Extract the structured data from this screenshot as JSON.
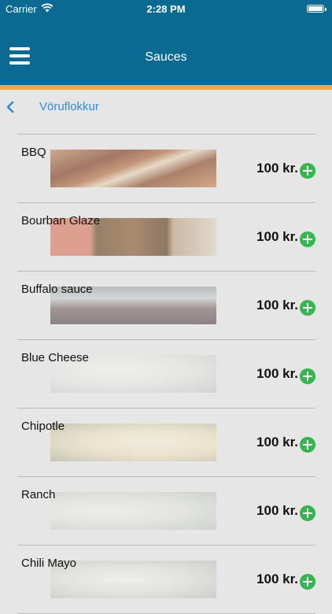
{
  "status_bar": {
    "carrier": "Carrier",
    "time": "2:28 PM"
  },
  "nav": {
    "title": "Sauces",
    "menu_icon": "hamburger-icon"
  },
  "back": {
    "label": "Vöruflokkur",
    "icon": "chevron-left-icon"
  },
  "colors": {
    "nav_bg": "#0b6a92",
    "accent_strip": "#f0a44a",
    "link": "#2f8be0",
    "add_button": "#33b74e"
  },
  "products": [
    {
      "name": "BBQ",
      "price": "100 kr."
    },
    {
      "name": "Bourban Glaze",
      "price": "100 kr."
    },
    {
      "name": "Buffalo sauce",
      "price": "100 kr."
    },
    {
      "name": "Blue Cheese",
      "price": "100 kr."
    },
    {
      "name": "Chipotle",
      "price": "100 kr."
    },
    {
      "name": "Ranch",
      "price": "100 kr."
    },
    {
      "name": "Chili Mayo",
      "price": "100 kr."
    }
  ]
}
